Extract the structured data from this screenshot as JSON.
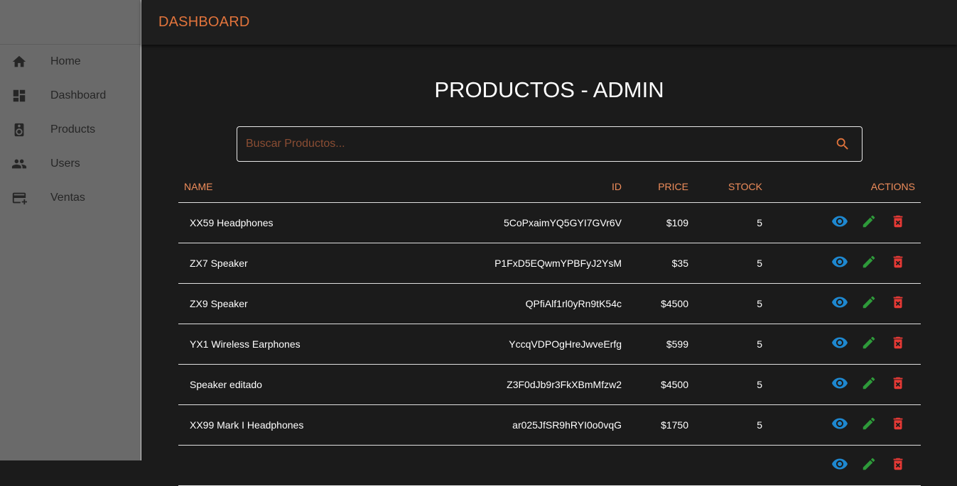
{
  "appbar": {
    "title": "DASHBOARD"
  },
  "sidebar": {
    "items": [
      {
        "label": "Home",
        "icon": "home-icon"
      },
      {
        "label": "Dashboard",
        "icon": "dashboard-icon"
      },
      {
        "label": "Products",
        "icon": "speaker-icon"
      },
      {
        "label": "Users",
        "icon": "people-icon"
      },
      {
        "label": "Ventas",
        "icon": "credit-card-add-icon"
      }
    ]
  },
  "main": {
    "title": "PRODUCTOS - ADMIN",
    "search": {
      "placeholder": "Buscar Productos...",
      "value": ""
    },
    "table": {
      "headers": {
        "name": "NAME",
        "id": "ID",
        "price": "PRICE",
        "stock": "STOCK",
        "actions": "ACTIONS"
      },
      "rows": [
        {
          "name": "XX59 Headphones",
          "id": "5CoPxaimYQ5GYI7GVr6V",
          "price": "$109",
          "stock": "5"
        },
        {
          "name": "ZX7 Speaker",
          "id": "P1FxD5EQwmYPBFyJ2YsM",
          "price": "$35",
          "stock": "5"
        },
        {
          "name": "ZX9 Speaker",
          "id": "QPfiAlf1rl0yRn9tK54c",
          "price": "$4500",
          "stock": "5"
        },
        {
          "name": "YX1 Wireless Earphones",
          "id": "YccqVDPOgHreJwveErfg",
          "price": "$599",
          "stock": "5"
        },
        {
          "name": "Speaker editado",
          "id": "Z3F0dJb9r3FkXBmMfzw2",
          "price": "$4500",
          "stock": "5"
        },
        {
          "name": "XX99 Mark I Headphones",
          "id": "ar025JfSR9hRYI0o0vqG",
          "price": "$1750",
          "stock": "5"
        },
        {
          "name": "",
          "id": "",
          "price": "",
          "stock": ""
        }
      ]
    }
  },
  "colors": {
    "accent": "#e2743c",
    "header_text": "#ef8d5b",
    "view": "#1e88d0",
    "edit": "#2e9a3a",
    "delete": "#e53935"
  }
}
